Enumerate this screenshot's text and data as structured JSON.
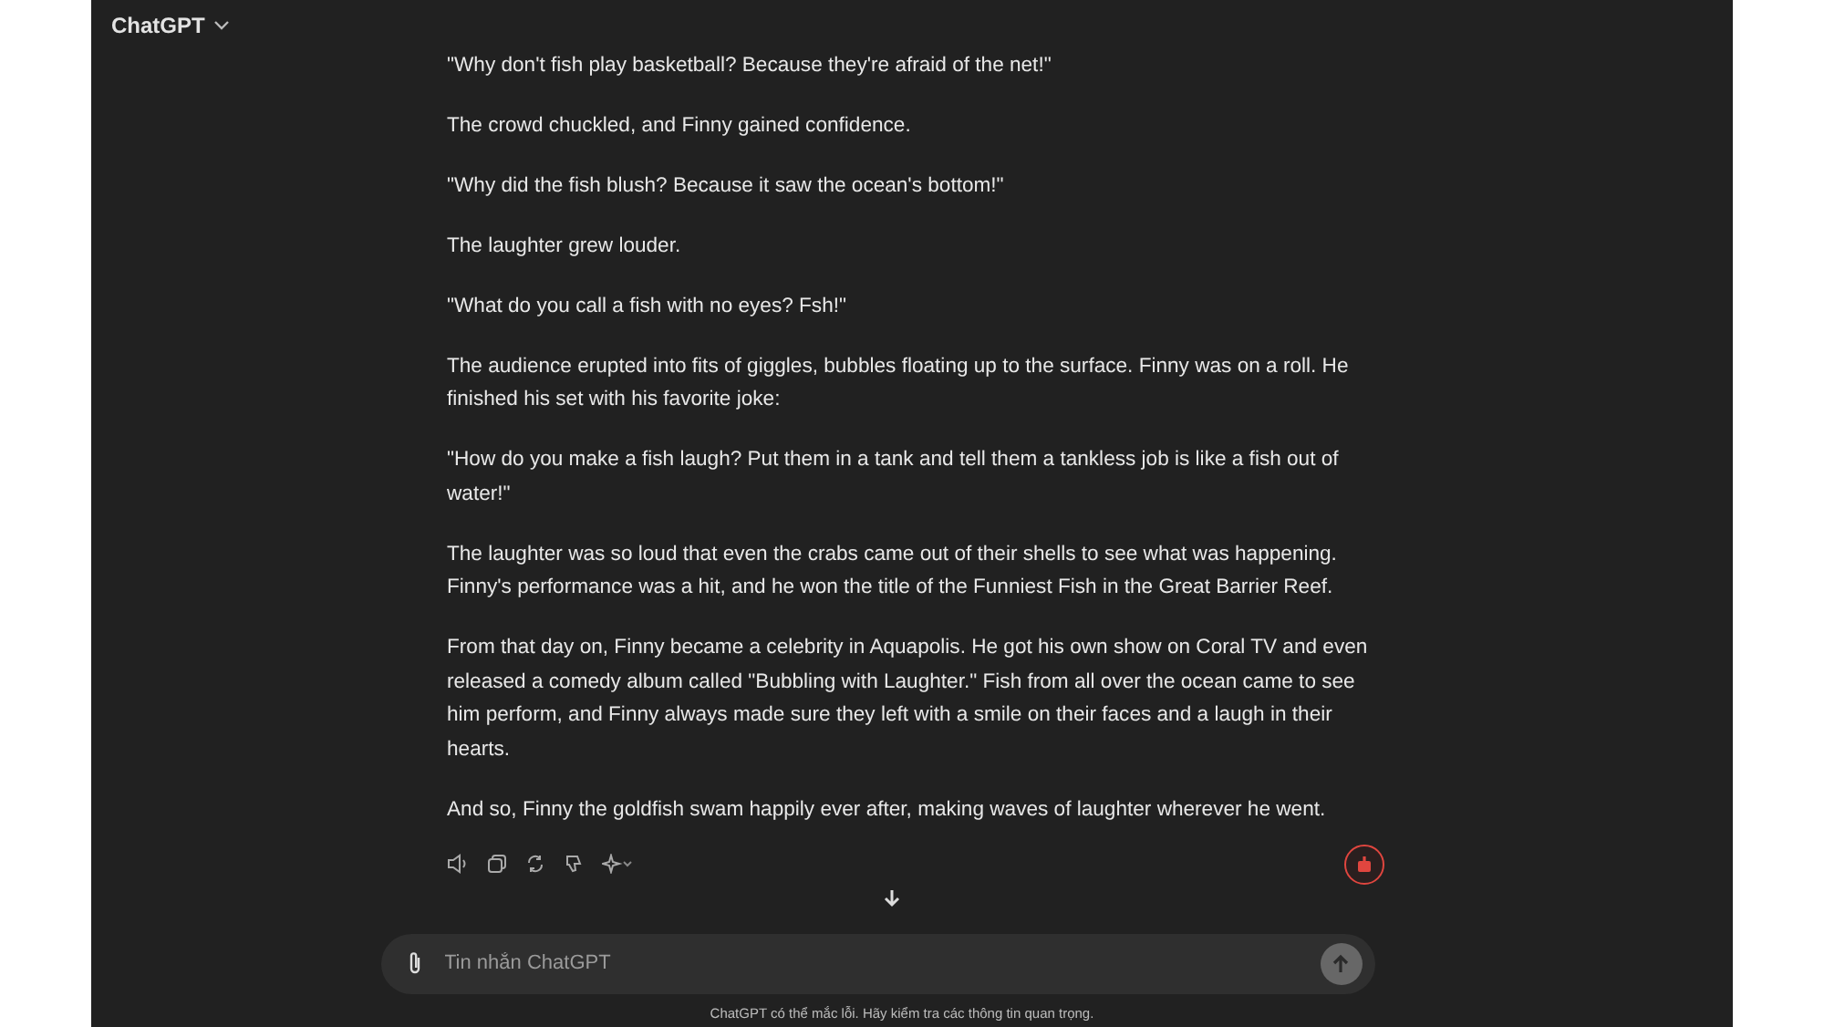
{
  "header": {
    "title": "ChatGPT"
  },
  "message": {
    "paragraphs": [
      "\"Why don't fish play basketball? Because they're afraid of the net!\"",
      "The crowd chuckled, and Finny gained confidence.",
      "\"Why did the fish blush? Because it saw the ocean's bottom!\"",
      "The laughter grew louder.",
      "\"What do you call a fish with no eyes? Fsh!\"",
      "The audience erupted into fits of giggles, bubbles floating up to the surface. Finny was on a roll. He finished his set with his favorite joke:",
      "\"How do you make a fish laugh? Put them in a tank and tell them a tankless job is like a fish out of water!\"",
      "The laughter was so loud that even the crabs came out of their shells to see what was happening. Finny's performance was a hit, and he won the title of the Funniest Fish in the Great Barrier Reef.",
      "From that day on, Finny became a celebrity in Aquapolis. He got his own show on Coral TV and even released a comedy album called \"Bubbling with Laughter.\" Fish from all over the ocean came to see him perform, and Finny always made sure they left with a smile on their faces and a laugh in their hearts.",
      "And so, Finny the goldfish swam happily ever after, making waves of laughter wherever he went."
    ]
  },
  "composer": {
    "placeholder": "Tin nhắn ChatGPT"
  },
  "disclaimer": "ChatGPT có thể mắc lỗi. Hãy kiểm tra các thông tin quan trọng."
}
